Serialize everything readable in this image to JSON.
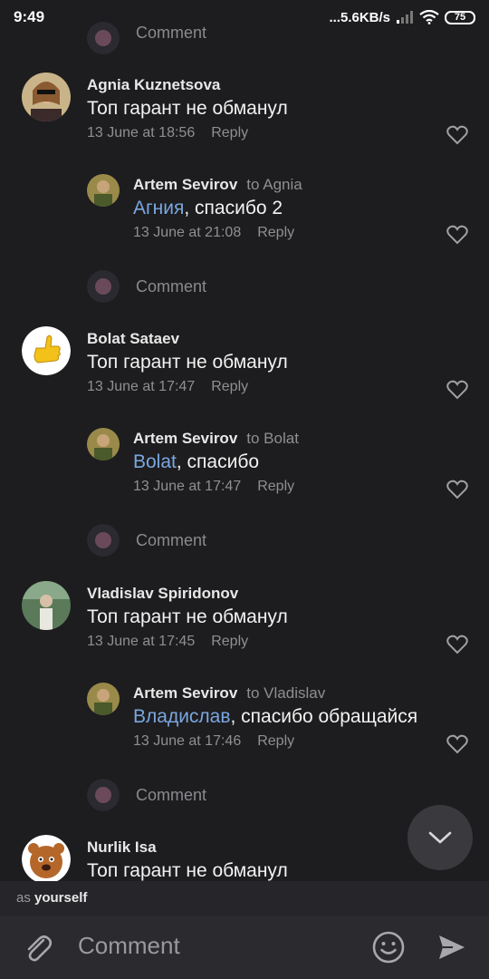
{
  "status": {
    "time": "9:49",
    "network": "...5.6KB/s",
    "battery": "75"
  },
  "comments": [
    {
      "author": "Agnia Kuznetsova",
      "text": "Топ гарант не обманул",
      "date": "13 June at 18:56",
      "reply_label": "Reply",
      "reply": {
        "author": "Artem Sevirov",
        "to": "to Agnia",
        "mention": "Агния",
        "rest": ", спасибо 2",
        "date": "13 June at 21:08",
        "reply_label": "Reply"
      }
    },
    {
      "author": "Bolat Sataev",
      "text": "Топ гарант не обманул",
      "date": "13 June at 17:47",
      "reply_label": "Reply",
      "reply": {
        "author": "Artem Sevirov",
        "to": "to Bolat",
        "mention": "Bolat",
        "rest": ", спасибо",
        "date": "13 June at 17:47",
        "reply_label": "Reply"
      }
    },
    {
      "author": "Vladislav Spiridonov",
      "text": "Топ гарант не обманул",
      "date": "13 June at 17:45",
      "reply_label": "Reply",
      "reply": {
        "author": "Artem Sevirov",
        "to": "to Vladislav",
        "mention": "Владислав",
        "rest": ", спасибо обращайся",
        "date": "13 June at 17:46",
        "reply_label": "Reply"
      }
    },
    {
      "author": "Nurlik Isa",
      "text": "Топ гарант не обманул"
    }
  ],
  "comment_link_label": "Comment",
  "composer": {
    "as_prefix": "as ",
    "as_value": "yourself",
    "placeholder": "Comment"
  },
  "icons": {
    "attach": "paperclip-icon",
    "emoji": "smile-icon",
    "send": "send-icon",
    "scroll": "chevron-down-icon",
    "like": "heart-icon"
  }
}
